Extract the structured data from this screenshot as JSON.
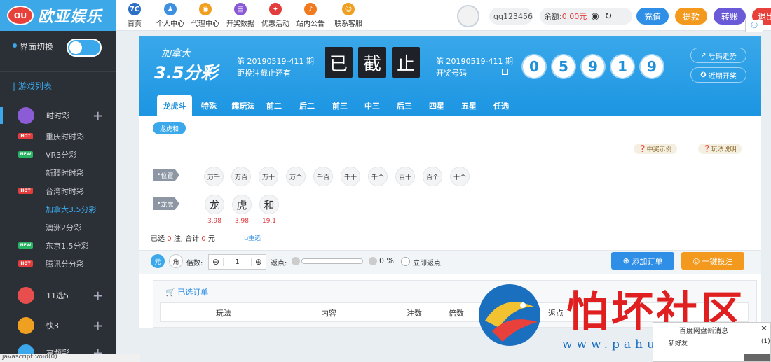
{
  "logo": {
    "badge": "OU",
    "text": "欧亚娱乐"
  },
  "nav": [
    {
      "label": "首页",
      "icon": "home-icon",
      "color": "#2c6fc7",
      "glyph": "7C"
    },
    {
      "label": "个人中心",
      "icon": "user-icon",
      "color": "#3d8fe0",
      "glyph": "♟"
    },
    {
      "label": "代理中心",
      "icon": "agent-icon",
      "color": "#f0a020",
      "glyph": "◉"
    },
    {
      "label": "开奖数据",
      "icon": "data-icon",
      "color": "#8a58d6",
      "glyph": "▤"
    },
    {
      "label": "优惠活动",
      "icon": "gift-icon",
      "color": "#e23c3c",
      "glyph": "✦"
    },
    {
      "label": "站内公告",
      "icon": "notice-icon",
      "color": "#f07a20",
      "glyph": "♪"
    },
    {
      "label": "联系客服",
      "icon": "service-icon",
      "color": "#f0a020",
      "glyph": "☺"
    }
  ],
  "user": {
    "name": "qq123456",
    "balance_label": "余额:",
    "balance": "0.00元"
  },
  "buttons": {
    "recharge": "充值",
    "withdraw": "提款",
    "transfer": "转账",
    "logout": "退出"
  },
  "sidebar": {
    "mode_label": "界面切换",
    "list_title": "游戏列表",
    "groups": [
      {
        "label": "时时彩",
        "color": "#8b5cd6"
      },
      {
        "label": "11选5",
        "color": "#e84e4e"
      },
      {
        "label": "快3",
        "color": "#f0a020"
      },
      {
        "label": "高频彩",
        "color": "#3aa8ea"
      }
    ],
    "items": [
      {
        "label": "重庆时时彩",
        "tag": "HOT",
        "tag_color": "#e23c3c"
      },
      {
        "label": "VR3分彩",
        "tag": "NEW",
        "tag_color": "#28b463"
      },
      {
        "label": "新疆时时彩",
        "tag": ""
      },
      {
        "label": "台湾时时彩",
        "tag": "HOT",
        "tag_color": "#e23c3c"
      },
      {
        "label": "加拿大3.5分彩",
        "tag": ""
      },
      {
        "label": "澳洲2分彩",
        "tag": ""
      },
      {
        "label": "东京1.5分彩",
        "tag": "NEW",
        "tag_color": "#28b463"
      },
      {
        "label": "腾讯分分彩",
        "tag": "HOT",
        "tag_color": "#e23c3c"
      }
    ]
  },
  "game": {
    "title_top": "加拿大",
    "title_bottom": "3.5分彩",
    "period": "第 20190519-411 期",
    "countdown_label": "距投注截止还有",
    "closed": [
      "已",
      "截",
      "止"
    ],
    "draw_period": "第 20190519-411 期",
    "draw_label": "开奖号码",
    "draw_numbers": [
      "0",
      "5",
      "9",
      "1",
      "9"
    ],
    "trend": "号码走势",
    "recent": "近期开奖"
  },
  "tabs": [
    "龙虎斗",
    "特殊",
    "趣玩法",
    "前二",
    "后二",
    "前三",
    "中三",
    "后三",
    "四星",
    "五星",
    "任选"
  ],
  "subtab": "龙虎和",
  "help": {
    "example": "中奖示例",
    "rules": "玩法说明"
  },
  "positions_label": "位置",
  "positions": [
    "万千",
    "万百",
    "万十",
    "万个",
    "千百",
    "千十",
    "千个",
    "百十",
    "百个",
    "十个"
  ],
  "lh_label": "龙虎",
  "lh_options": [
    {
      "label": "龙",
      "odds": "3.98"
    },
    {
      "label": "虎",
      "odds": "3.98"
    },
    {
      "label": "和",
      "odds": "19.1"
    }
  ],
  "summary": {
    "prefix": "已选",
    "count": "0",
    "mid": "注, 合计",
    "amount": "0",
    "suffix": "元",
    "reset": "重选"
  },
  "bet": {
    "unit_yuan": "元",
    "unit_jiao": "角",
    "multiple_label": "倍数:",
    "multiple": "1",
    "rebate_label": "返点:",
    "rebate": "0 %",
    "instant_rebate": "立即返点",
    "add_order": "添加订单",
    "one_click": "一键投注"
  },
  "orders": {
    "title": "已选订单",
    "cols": [
      "玩法",
      "内容",
      "注数",
      "倍数",
      "返点"
    ]
  },
  "popup": {
    "title": "百度网盘新消息",
    "body": "新好友",
    "count": "(1)"
  },
  "watermark": {
    "name": "怕坏社区",
    "url": "www.pahuai.com"
  },
  "status": "javascript:void(0)"
}
